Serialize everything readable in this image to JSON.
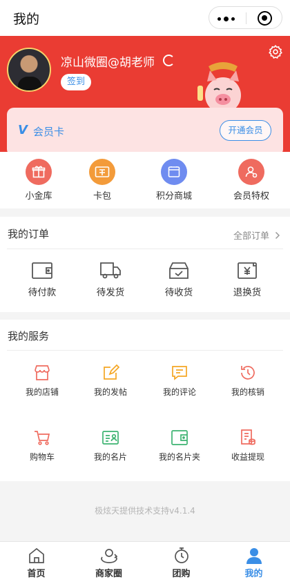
{
  "nav": {
    "title": "我的"
  },
  "profile": {
    "nickname": "凉山微圈@胡老师",
    "checkin_label": "签到"
  },
  "vip": {
    "label": "会员卡",
    "button": "开通会员"
  },
  "quick_menu": [
    {
      "label": "小金库",
      "icon": "gift-icon",
      "color": "#ef6b5f"
    },
    {
      "label": "卡包",
      "icon": "coupon-icon",
      "color": "#f39b3a"
    },
    {
      "label": "积分商城",
      "icon": "shop-icon",
      "color": "#6f8cf0"
    },
    {
      "label": "会员特权",
      "icon": "member-icon",
      "color": "#ef6b5f"
    }
  ],
  "orders": {
    "title": "我的订单",
    "more": "全部订单",
    "items": [
      {
        "label": "待付款",
        "icon": "wallet-icon"
      },
      {
        "label": "待发货",
        "icon": "truck-icon"
      },
      {
        "label": "待收货",
        "icon": "box-icon"
      },
      {
        "label": "退换货",
        "icon": "refund-icon"
      }
    ]
  },
  "services": {
    "title": "我的服务",
    "items": [
      {
        "label": "我的店铺",
        "icon": "store-icon",
        "color": "#ef6b5f"
      },
      {
        "label": "我的发帖",
        "icon": "edit-icon",
        "color": "#f5a623"
      },
      {
        "label": "我的评论",
        "icon": "comment-icon",
        "color": "#f5a623"
      },
      {
        "label": "我的核销",
        "icon": "history-icon",
        "color": "#ef6b5f"
      },
      {
        "label": "购物车",
        "icon": "cart-icon",
        "color": "#ef6b5f"
      },
      {
        "label": "我的名片",
        "icon": "card-icon",
        "color": "#3cb371"
      },
      {
        "label": "我的名片夹",
        "icon": "cardholder-icon",
        "color": "#3cb371"
      },
      {
        "label": "收益提现",
        "icon": "withdraw-icon",
        "color": "#ef6b5f"
      }
    ]
  },
  "footer": {
    "text": "极炫天提供技术支持v4.1.4"
  },
  "tabs": [
    {
      "label": "首页",
      "icon": "home-icon"
    },
    {
      "label": "商家圈",
      "icon": "merchant-circle-icon"
    },
    {
      "label": "团购",
      "icon": "group-buy-icon"
    },
    {
      "label": "我的",
      "icon": "user-icon",
      "active": true
    }
  ],
  "colors": {
    "brand_red": "#ea3c33",
    "accent_blue": "#3a8ee6"
  }
}
